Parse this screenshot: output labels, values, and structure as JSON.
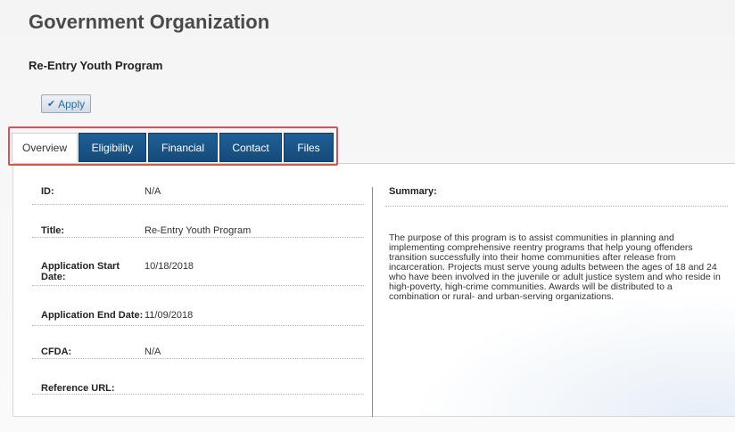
{
  "header": {
    "org_title": "Government Organization",
    "program_title": "Re-Entry Youth Program",
    "apply_label": "Apply",
    "apply_icon": "check-icon"
  },
  "tabs": [
    {
      "label": "Overview",
      "active": true
    },
    {
      "label": "Eligibility",
      "active": false
    },
    {
      "label": "Financial",
      "active": false
    },
    {
      "label": "Contact",
      "active": false
    },
    {
      "label": "Files",
      "active": false
    }
  ],
  "fields": {
    "id": {
      "label": "ID:",
      "value": "N/A"
    },
    "title": {
      "label": "Title:",
      "value": "Re-Entry Youth Program"
    },
    "app_start": {
      "label": "Application Start\nDate:",
      "value": "10/18/2018"
    },
    "app_end": {
      "label": "Application End Date:",
      "value": "11/09/2018"
    },
    "cfda": {
      "label": "CFDA:",
      "value": "N/A"
    },
    "ref_url": {
      "label": "Reference URL:",
      "value": ""
    }
  },
  "summary": {
    "label": "Summary:",
    "text": "The purpose of this program is to assist communities in planning and\nimplementing comprehensive reentry programs that help young offenders\ntransition successfully into their home communities after release from\nincarceration. Projects must serve young adults between the ages of 18 and 24\nwho have been involved in the juvenile or adult justice system and who reside in\nhigh-poverty, high-crime communities. Awards will be distributed to a\ncombination or rural- and urban-serving organizations."
  },
  "colors": {
    "tab_active_bg": "#ffffff",
    "tab_inactive_bg": "#1a5586",
    "highlight_border": "#d9534f",
    "apply_text": "#2e6c9e"
  }
}
